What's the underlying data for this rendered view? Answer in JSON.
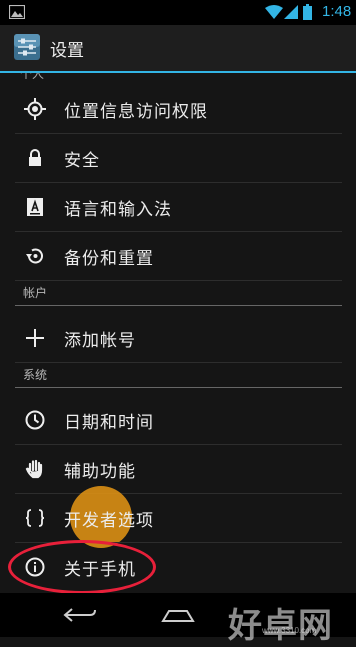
{
  "status_bar": {
    "time": "1:48",
    "icons": [
      "gallery-icon",
      "wifi-icon",
      "signal-icon",
      "battery-icon"
    ],
    "accent": "#33b5e5"
  },
  "action_bar": {
    "title": "设置",
    "icon": "settings-icon"
  },
  "settings": {
    "cut_header": "个人",
    "personal_items": [
      {
        "label": "位置信息访问权限",
        "icon": "location-icon"
      },
      {
        "label": "安全",
        "icon": "lock-icon"
      },
      {
        "label": "语言和输入法",
        "icon": "keyboard-icon"
      },
      {
        "label": "备份和重置",
        "icon": "restore-icon"
      }
    ],
    "accounts_header": "帐户",
    "account_items": [
      {
        "label": "添加帐号",
        "icon": "plus-icon"
      }
    ],
    "system_header": "系统",
    "system_items": [
      {
        "label": "日期和时间",
        "icon": "clock-icon"
      },
      {
        "label": "辅助功能",
        "icon": "hand-icon"
      },
      {
        "label": "开发者选项",
        "icon": "braces-icon"
      },
      {
        "label": "关于手机",
        "icon": "info-icon"
      }
    ]
  },
  "nav_bar": {
    "icons": [
      "back-icon",
      "home-icon"
    ]
  },
  "watermark": {
    "text": "好卓网",
    "url": "www.3310.com"
  },
  "colors": {
    "accent": "#33b5e5",
    "highlight": "#e8961a",
    "annotation": "#e8203a"
  }
}
